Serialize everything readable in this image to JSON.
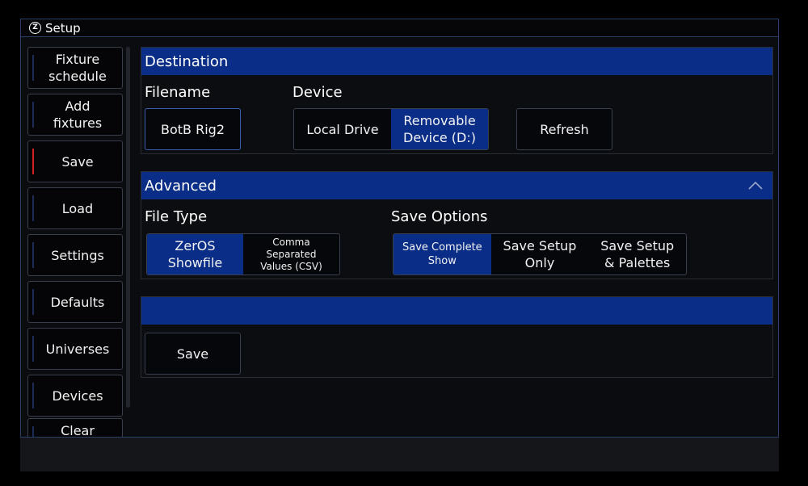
{
  "window": {
    "title": "Setup",
    "logo_letter": "Z"
  },
  "sidebar": {
    "items": [
      {
        "label": "Fixture\nschedule"
      },
      {
        "label": "Add\nfixtures"
      },
      {
        "label": "Save"
      },
      {
        "label": "Load"
      },
      {
        "label": "Settings"
      },
      {
        "label": "Defaults"
      },
      {
        "label": "Universes"
      },
      {
        "label": "Devices"
      },
      {
        "label": "Clear"
      }
    ],
    "active_item": "Save"
  },
  "destination": {
    "header": "Destination",
    "filename_label": "Filename",
    "filename_value": "BotB Rig2",
    "device_label": "Device",
    "device_options": [
      "Local Drive",
      "Removable\nDevice (D:)"
    ],
    "device_selected": "Removable\nDevice (D:)",
    "refresh_label": "Refresh"
  },
  "advanced": {
    "header": "Advanced",
    "collapse_icon": "chevron-up-icon",
    "file_type_label": "File Type",
    "file_type_options": [
      "ZerOS\nShowfile",
      "Comma\nSeparated\nValues (CSV)"
    ],
    "file_type_selected": "ZerOS\nShowfile",
    "save_options_label": "Save Options",
    "save_options": [
      "Save Complete\nShow",
      "Save Setup\nOnly",
      "Save Setup\n& Palettes"
    ],
    "save_option_selected": "Save Complete\nShow"
  },
  "action": {
    "header": "",
    "save_label": "Save"
  },
  "colors": {
    "header_blue": "#0a2e87",
    "selected_blue": "#0a2e87",
    "active_indicator": "#d21f1f",
    "background": "#0b0c10"
  }
}
